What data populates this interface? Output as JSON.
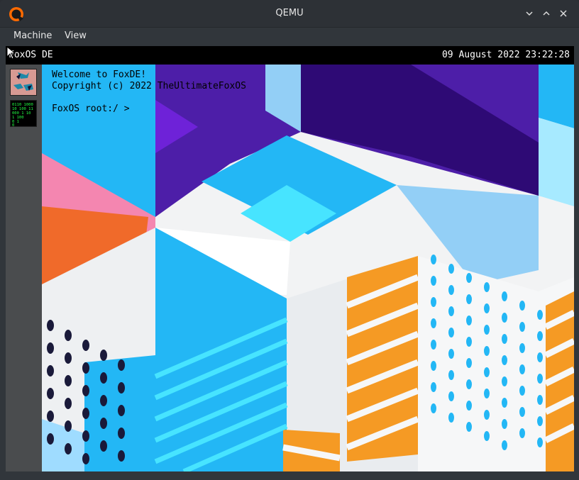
{
  "window": {
    "title": "QEMU"
  },
  "menubar": {
    "items": [
      "Machine",
      "View"
    ]
  },
  "guest": {
    "topbar": {
      "name": "FoxOS DE",
      "datetime": "09 August 2022 23:22:28"
    },
    "terminal": {
      "line1": "Welcome to FoxDE!",
      "line2": "Copyright (c) 2022 TheUltimateFoxOS",
      "prompt": "FoxOS root:/ >"
    },
    "dock": {
      "icons": [
        "foxes-app-icon",
        "matrix-app-icon"
      ]
    },
    "matrix_icon_text": [
      "0110 1000",
      "10 100 11",
      "000 1 10",
      " 1  100",
      "   0 1",
      "    0"
    ]
  },
  "colors": {
    "window_bg": "#31363b",
    "titlebar_bg": "#2d3136",
    "dock_bg": "#4a4c4e",
    "sky_blue": "#23b7f5",
    "purple": "#5720b0",
    "orange": "#f59a24",
    "pink": "#f486b0",
    "cyan": "#47e4ff"
  }
}
